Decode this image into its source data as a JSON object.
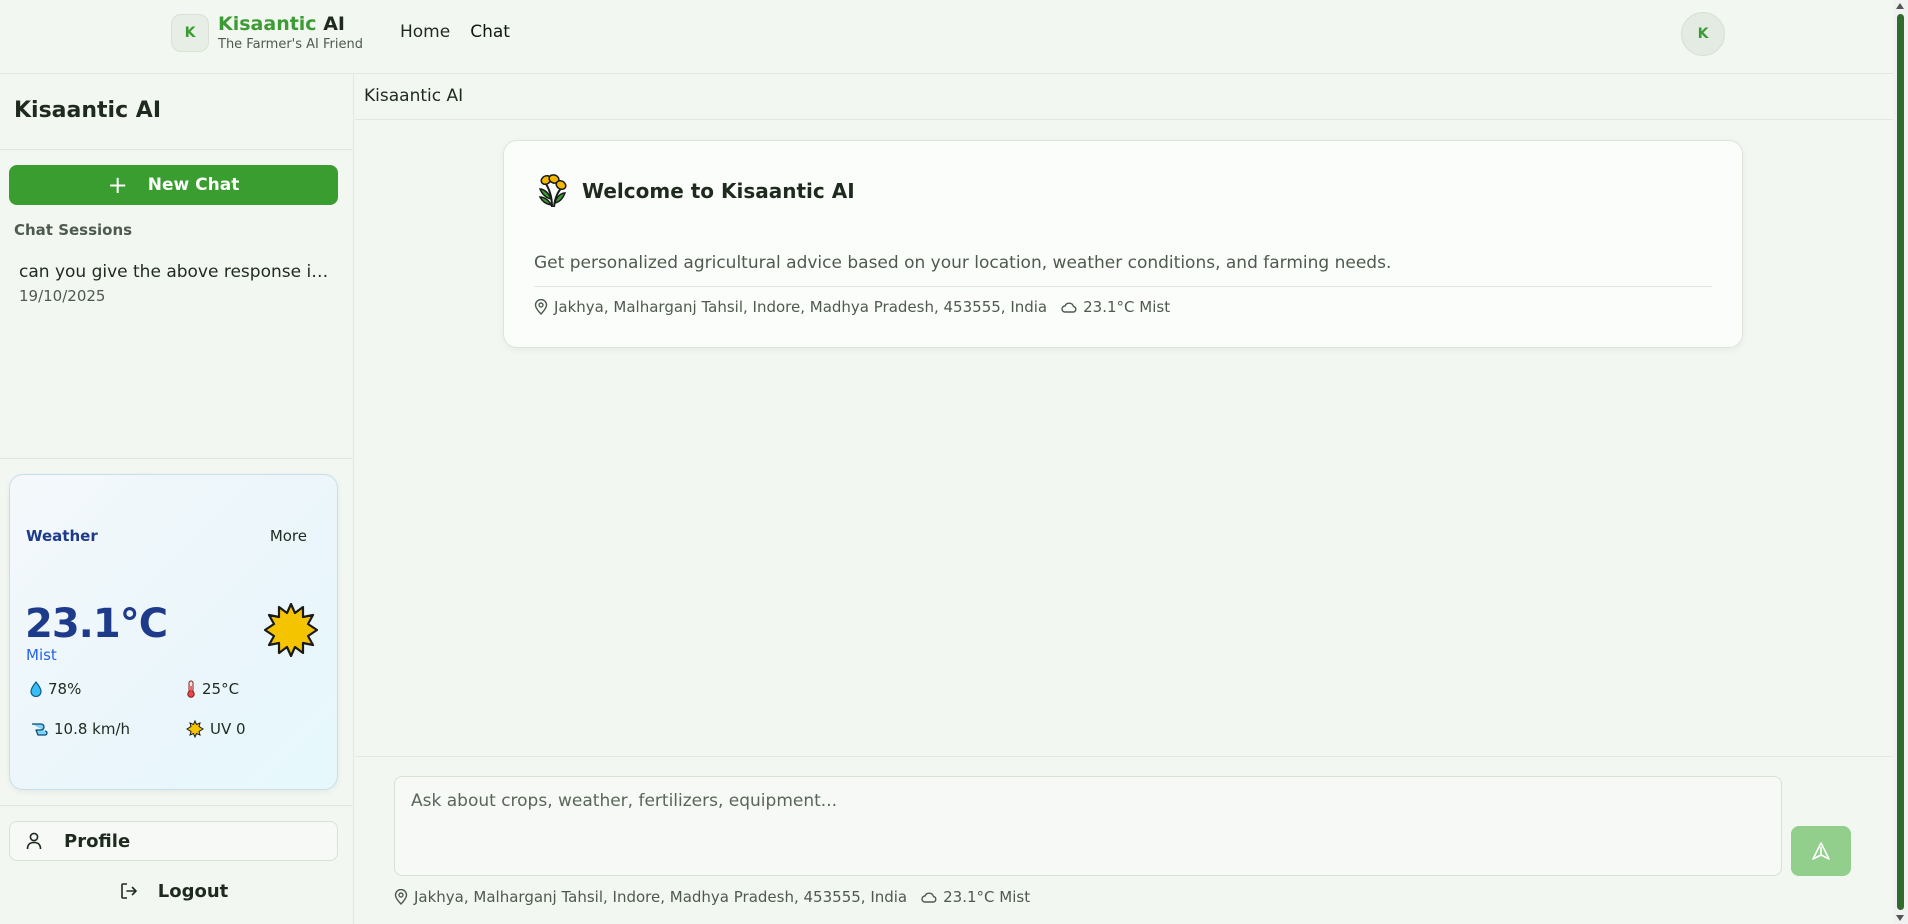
{
  "header": {
    "logo_letter": "K",
    "brand_name_accent": "Kisaantic",
    "brand_name_rest": " AI",
    "tagline": "The Farmer's AI Friend",
    "nav": [
      {
        "label": "Home"
      },
      {
        "label": "Chat"
      }
    ],
    "avatar_letter": "K",
    "active_nav": "Chat"
  },
  "sidebar": {
    "title": "Kisaantic AI",
    "new_chat_label": "New Chat",
    "sessions_label": "Chat Sessions",
    "sessions": [
      {
        "title": "can you give the above response in g...",
        "date": "19/10/2025"
      }
    ],
    "profile_label": "Profile",
    "logout_label": "Logout"
  },
  "weather": {
    "label": "Weather",
    "more_label": "More",
    "temperature": "23.1°C",
    "condition": "Mist",
    "humidity": "78%",
    "feels_like": "25°C",
    "wind": "10.8 km/h",
    "uv": "UV 0",
    "icon": "sun-icon"
  },
  "main": {
    "header_title": "Kisaantic AI",
    "welcome_title": "Welcome to Kisaantic AI",
    "welcome_subtitle": "Get personalized agricultural advice based on your location, weather conditions, and farming needs.",
    "location": "Jakhya, Malharganj Tahsil, Indore, Madhya Pradesh, 453555, India",
    "weather_summary": "23.1°C Mist",
    "input_placeholder": "Ask about crops, weather, fertilizers, equipment...",
    "input_value": ""
  },
  "colors": {
    "brand_green": "#3a9d2f",
    "send_button_disabled": "#93cf8c",
    "weather_blue": "#1e3a8a",
    "background": "#f3f7f1"
  }
}
